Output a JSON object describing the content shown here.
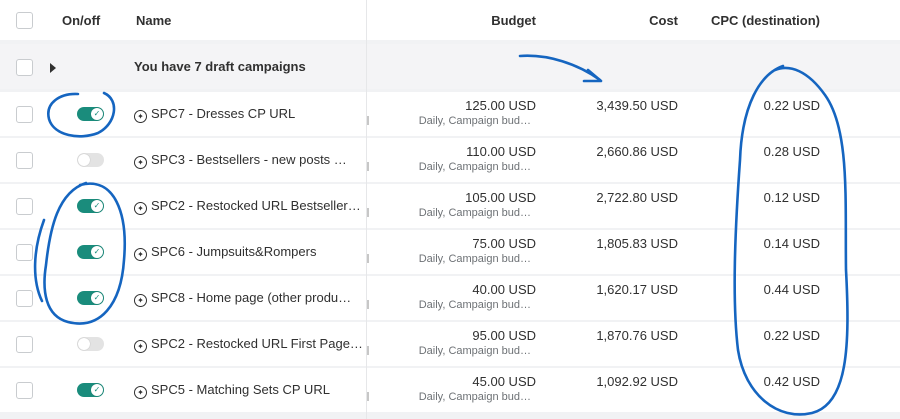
{
  "header": {
    "onoff": "On/off",
    "name": "Name",
    "budget": "Budget",
    "cost": "Cost",
    "cpc": "CPC (destination)"
  },
  "draft_row": {
    "text": "You have 7 draft campaigns"
  },
  "campaigns": [
    {
      "on": true,
      "name": "SPC7 - Dresses CP URL",
      "budget": "125.00 USD",
      "budget_sub": "Daily, Campaign bud…",
      "cost": "3,439.50 USD",
      "cpc": "0.22 USD"
    },
    {
      "on": false,
      "name": "SPC3 - Bestsellers - new posts …",
      "budget": "110.00 USD",
      "budget_sub": "Daily, Campaign bud…",
      "cost": "2,660.86 USD",
      "cpc": "0.28 USD"
    },
    {
      "on": true,
      "name": "SPC2 - Restocked URL Bestseller…",
      "budget": "105.00 USD",
      "budget_sub": "Daily, Campaign bud…",
      "cost": "2,722.80 USD",
      "cpc": "0.12 USD"
    },
    {
      "on": true,
      "name": "SPC6 - Jumpsuits&Rompers",
      "budget": "75.00 USD",
      "budget_sub": "Daily, Campaign bud…",
      "cost": "1,805.83 USD",
      "cpc": "0.14 USD"
    },
    {
      "on": true,
      "name": "SPC8 - Home page (other produ…",
      "budget": "40.00 USD",
      "budget_sub": "Daily, Campaign bud…",
      "cost": "1,620.17 USD",
      "cpc": "0.44 USD"
    },
    {
      "on": false,
      "name": "SPC2 - Restocked URL First Page…",
      "budget": "95.00 USD",
      "budget_sub": "Daily, Campaign bud…",
      "cost": "1,870.76 USD",
      "cpc": "0.22 USD"
    },
    {
      "on": true,
      "name": "SPC5 - Matching Sets CP URL",
      "budget": "45.00 USD",
      "budget_sub": "Daily, Campaign bud…",
      "cost": "1,092.92 USD",
      "cpc": "0.42 USD"
    }
  ],
  "icons": {
    "campaign": "advantage-plus-icon",
    "toggle_check": "check-icon",
    "expand": "caret-right-icon"
  },
  "colors": {
    "toggle_on": "#1a8c7c",
    "toggle_off": "#e3e3e3",
    "annotation": "#1565c0"
  }
}
